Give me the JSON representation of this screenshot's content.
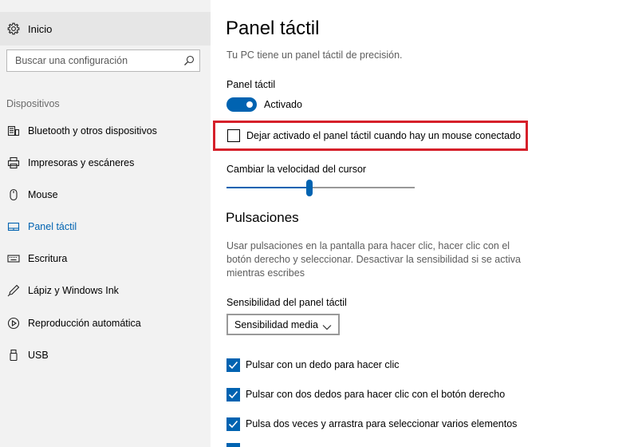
{
  "sidebar": {
    "home": {
      "label": "Inicio",
      "icon": "gear-icon"
    },
    "search": {
      "placeholder": "Buscar una configuración",
      "icon": "search-icon"
    },
    "section_label": "Dispositivos",
    "items": [
      {
        "label": "Bluetooth y otros dispositivos",
        "icon": "bluetooth-devices-icon"
      },
      {
        "label": "Impresoras y escáneres",
        "icon": "printer-icon"
      },
      {
        "label": "Mouse",
        "icon": "mouse-icon"
      },
      {
        "label": "Panel táctil",
        "icon": "touchpad-icon",
        "active": true
      },
      {
        "label": "Escritura",
        "icon": "keyboard-icon"
      },
      {
        "label": "Lápiz y Windows Ink",
        "icon": "pen-icon"
      },
      {
        "label": "Reproducción automática",
        "icon": "autoplay-icon"
      },
      {
        "label": "USB",
        "icon": "usb-icon"
      }
    ]
  },
  "main": {
    "title": "Panel táctil",
    "description": "Tu PC tiene un panel táctil de precisión.",
    "touchpad_label": "Panel táctil",
    "toggle": {
      "label": "Activado",
      "on": true
    },
    "mouse_option": {
      "label": "Dejar activado el panel táctil cuando hay un mouse conectado",
      "checked": false
    },
    "cursor_speed": {
      "label": "Cambiar la velocidad del cursor",
      "value_fraction": 0.44
    },
    "pulsaciones": {
      "heading": "Pulsaciones",
      "description": "Usar pulsaciones en la pantalla para hacer clic, hacer clic con el botón derecho y seleccionar. Desactivar la sensibilidad si se activa mientras escribes",
      "sensitivity_label": "Sensibilidad del panel táctil",
      "sensitivity_value": "Sensibilidad media",
      "options": [
        {
          "label": "Pulsar con un dedo para hacer clic",
          "checked": true
        },
        {
          "label": "Pulsar con dos dedos para hacer clic con el botón derecho",
          "checked": true
        },
        {
          "label": "Pulsa dos veces y arrastra para seleccionar varios elementos",
          "checked": true
        }
      ]
    }
  },
  "colors": {
    "accent": "#0063b1",
    "highlight": "#d6202a",
    "sidebar_bg": "#f2f2f2"
  }
}
